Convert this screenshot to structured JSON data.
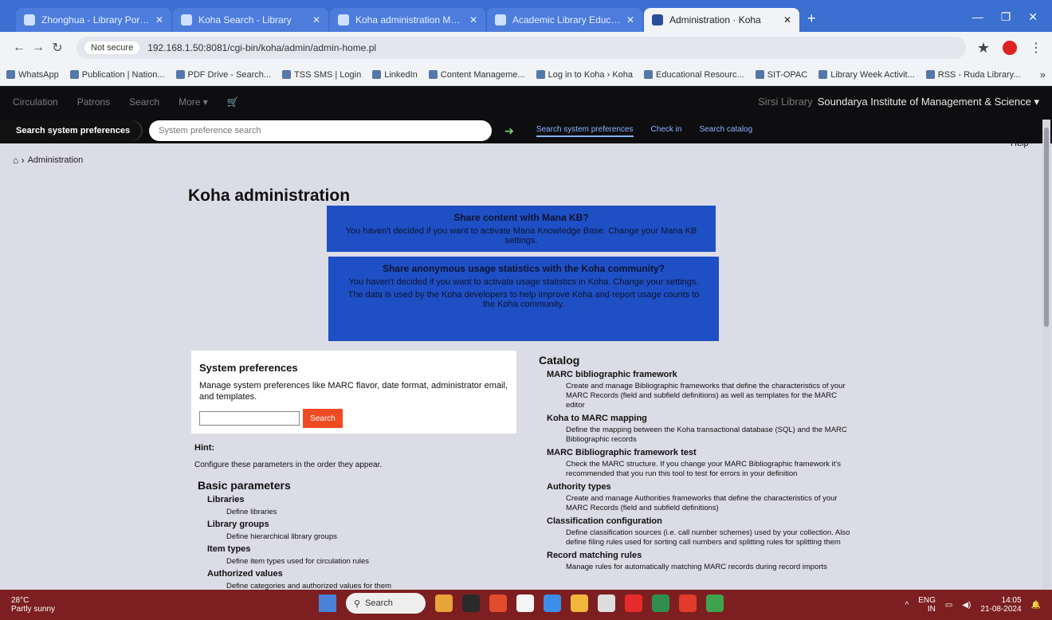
{
  "browser": {
    "tabs": [
      {
        "title": "Zhonghua - Library Portal Reading"
      },
      {
        "title": "Koha Search - Library"
      },
      {
        "title": "Koha administration Manual"
      },
      {
        "title": "Academic Library Education"
      },
      {
        "title": "Administration · Koha",
        "active": true
      }
    ],
    "new_tab": "+",
    "url_security": "Not secure",
    "url": "192.168.1.50:8081/cgi-bin/koha/admin/admin-home.pl",
    "bookmarks": [
      "WhatsApp",
      "Publication | Nation...",
      "PDF Drive - Search...",
      "TSS SMS | Login",
      "LinkedIn",
      "Content Manageme...",
      "Log in to Koha › Koha",
      "Educational Resourc...",
      "SIT-OPAC",
      "Library Week Activit...",
      "RSS - Ruda Library..."
    ],
    "bookmarks_more": "»"
  },
  "koha": {
    "nav": [
      "Circulation",
      "Patrons",
      "Search",
      "More ▾"
    ],
    "library_prefix": "Sirsi Library",
    "library_name": "Soundarya Institute of Management & Science ▾",
    "search_label": "Search system preferences",
    "search_placeholder": "System preference search",
    "search_tabs": [
      "Search system preferences",
      "Check in",
      "Search catalog"
    ],
    "help": "Help",
    "breadcrumb": "Administration",
    "page_title": "Koha administration",
    "notice1": {
      "title": "Share content with Mana KB?",
      "text": "You haven't decided if you want to activate Mana Knowledge Base. Change your Mana KB settings."
    },
    "notice2": {
      "title": "Share anonymous usage statistics with the Koha community?",
      "text1": "You haven't decided if you want to activate usage statistics in Koha. Change your settings.",
      "text2": "The data is used by the Koha developers to help improve Koha and report usage counts to the Koha community."
    },
    "sysprefs": {
      "title": "System preferences",
      "desc": "Manage system preferences like MARC flavor, date format, administrator email, and templates.",
      "button": "Search"
    },
    "hint_title": "Hint:",
    "hint_text": "Configure these parameters in the order they appear.",
    "basic_title": "Basic parameters",
    "basic_items": [
      {
        "name": "Libraries",
        "desc": "Define libraries"
      },
      {
        "name": "Library groups",
        "desc": "Define hierarchical library groups"
      },
      {
        "name": "Item types",
        "desc": "Define item types used for circulation rules"
      },
      {
        "name": "Authorized values",
        "desc": "Define categories and authorized values for them"
      }
    ],
    "catalog_title": "Catalog",
    "catalog_items": [
      {
        "name": "MARC bibliographic framework",
        "desc": "Create and manage Bibliographic frameworks that define the characteristics of your MARC Records (field and subfield definitions) as well as templates for the MARC editor"
      },
      {
        "name": "Koha to MARC mapping",
        "desc": "Define the mapping between the Koha transactional database (SQL) and the MARC Bibliographic records"
      },
      {
        "name": "MARC Bibliographic framework test",
        "desc": "Check the MARC structure. If you change your MARC Bibliographic framework it's recommended that you run this tool to test for errors in your definition"
      },
      {
        "name": "Authority types",
        "desc": "Create and manage Authorities frameworks that define the characteristics of your MARC Records (field and subfield definitions)"
      },
      {
        "name": "Classification configuration",
        "desc": "Define classification sources (i.e. call number schemes) used by your collection. Also define filing rules used for sorting call numbers and splitting rules for splitting them"
      },
      {
        "name": "Record matching rules",
        "desc": "Manage rules for automatically matching MARC records during record imports"
      }
    ]
  },
  "taskbar": {
    "weather_temp": "28°C",
    "weather_desc": "Partly sunny",
    "search": "Search",
    "lang": "ENG",
    "lang_sub": "IN",
    "time": "14:05",
    "date": "21-08-2024"
  },
  "colors": {
    "notice_bg": "#1f4fc4",
    "search_button": "#f04a23",
    "taskbar": "#7d1f20"
  }
}
